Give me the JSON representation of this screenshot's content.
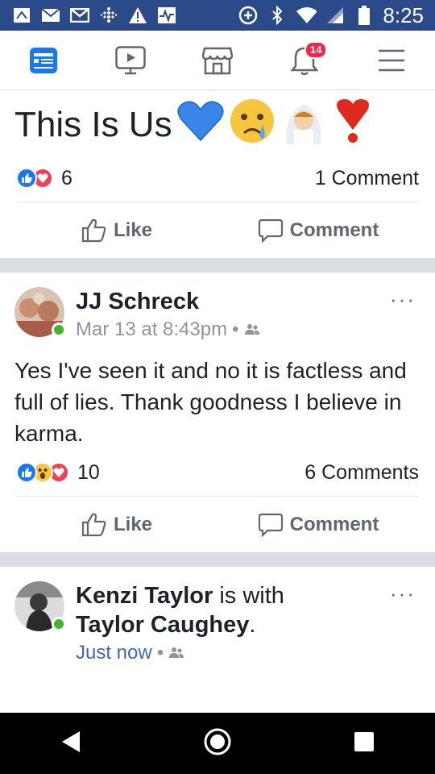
{
  "status_bar": {
    "time": "8:25",
    "icons": [
      "app-icon",
      "mail-icon",
      "gmail-icon",
      "fitbit-icon",
      "warning-icon",
      "activity-icon",
      "data-saver-icon",
      "bluetooth-icon",
      "wifi-icon",
      "signal-icon",
      "battery-icon"
    ]
  },
  "nav": {
    "items": [
      "news-feed-icon",
      "watch-icon",
      "marketplace-icon",
      "notifications-icon",
      "menu-icon"
    ],
    "notification_badge": "14",
    "accent_color": "#1877f2"
  },
  "post1": {
    "title": "This Is Us",
    "title_emojis": [
      "💙",
      "😢",
      "👰",
      "❗"
    ],
    "reaction_icons": [
      "like-reaction-icon",
      "love-reaction-icon"
    ],
    "reaction_count": "6",
    "comment_count": "1 Comment",
    "like_label": "Like",
    "comment_label": "Comment"
  },
  "post2": {
    "author": "JJ Schreck",
    "timestamp": "Mar 13 at 8:43pm",
    "separator": "•",
    "body": "Yes I've seen it and no it is factless and full of lies.  Thank goodness I believe in karma.",
    "reaction_icons": [
      "like-reaction-icon",
      "wow-reaction-icon",
      "love-reaction-icon"
    ],
    "reaction_count": "10",
    "comment_count": "6 Comments",
    "like_label": "Like",
    "comment_label": "Comment",
    "more_label": "···"
  },
  "post3": {
    "author": "Kenzi Taylor",
    "with_text": "is with",
    "tagged": "Taylor Caughey",
    "period": ".",
    "timestamp": "Just now",
    "separator": "•",
    "more_label": "···"
  },
  "bottom_nav": [
    "back-icon",
    "home-icon",
    "recents-icon"
  ]
}
